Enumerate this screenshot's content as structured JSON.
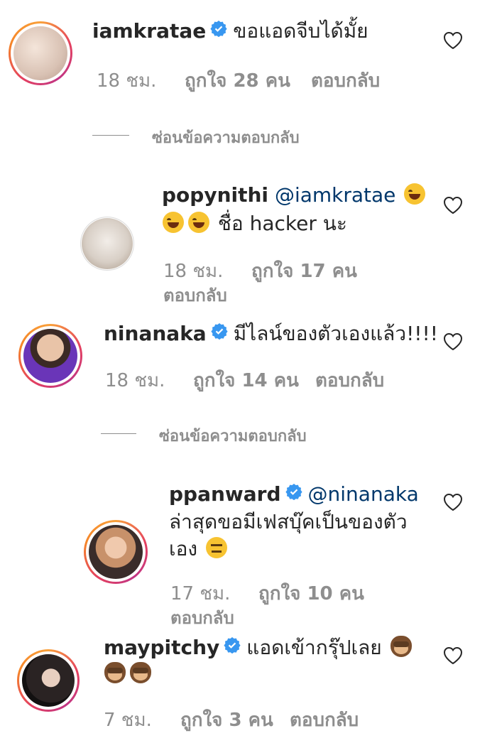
{
  "comments": [
    {
      "username": "iamkratae",
      "verified": true,
      "text": "ขอแอดจีบได้มั้ย",
      "time": "18 ชม.",
      "likes": "ถูกใจ 28 คน",
      "reply_label": "ตอบกลับ"
    },
    {
      "username": "popynithi",
      "mention": "@iamkratae",
      "text": "ชื่อ hacker นะ",
      "time": "18 ชม.",
      "likes": "ถูกใจ 17 คน",
      "reply_label": "ตอบกลับ"
    },
    {
      "username": "ninanaka",
      "verified": true,
      "text": "มีไลน์ของตัวเองแล้ว!!!!",
      "time": "18 ชม.",
      "likes": "ถูกใจ 14 คน",
      "reply_label": "ตอบกลับ"
    },
    {
      "username": "ppanward",
      "verified": true,
      "mention": "@ninanaka",
      "text_line1": "ล่าสุดขอมีเฟสบุ๊คเป็นของตัว",
      "text_line2": "เอง",
      "time": "17 ชม.",
      "likes": "ถูกใจ 10 คน",
      "reply_label": "ตอบกลับ"
    },
    {
      "username": "maypitchy",
      "verified": true,
      "text": "แอดเข้ากรุ๊ปเลย",
      "time": "7 ชม.",
      "likes": "ถูกใจ 3 คน",
      "reply_label": "ตอบกลับ"
    }
  ],
  "hide_replies_label": "ซ่อนข้อความตอบกลับ",
  "colors": {
    "verified": "#3897f0",
    "text": "#262626",
    "muted": "#8e8e8e",
    "mention": "#00376b"
  }
}
